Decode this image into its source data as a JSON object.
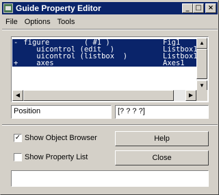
{
  "window": {
    "title": "Guide Property Editor",
    "controls": {
      "minimize": "_",
      "maximize": "□",
      "close": "×"
    }
  },
  "menu": [
    "File",
    "Options",
    "Tools"
  ],
  "object_list": [
    {
      "marker": "-",
      "text": " figure        ( #1 )",
      "name": "Fig1"
    },
    {
      "marker": "",
      "text": "    uicontrol (edit  )",
      "name": "Listbox1"
    },
    {
      "marker": "",
      "text": "    uicontrol (listbox  )",
      "name": "Listbox1"
    },
    {
      "marker": "+",
      "text": "    axes",
      "name": "Axes1"
    }
  ],
  "property": {
    "name": "Position",
    "value": "[? ? ? ?]"
  },
  "options": {
    "show_object_browser": {
      "label": "Show Object Browser",
      "checked": true,
      "mark": "✓"
    },
    "show_property_list": {
      "label": "Show Property List",
      "checked": false,
      "mark": ""
    }
  },
  "buttons": {
    "help": "Help",
    "close": "Close"
  },
  "status_text": ""
}
